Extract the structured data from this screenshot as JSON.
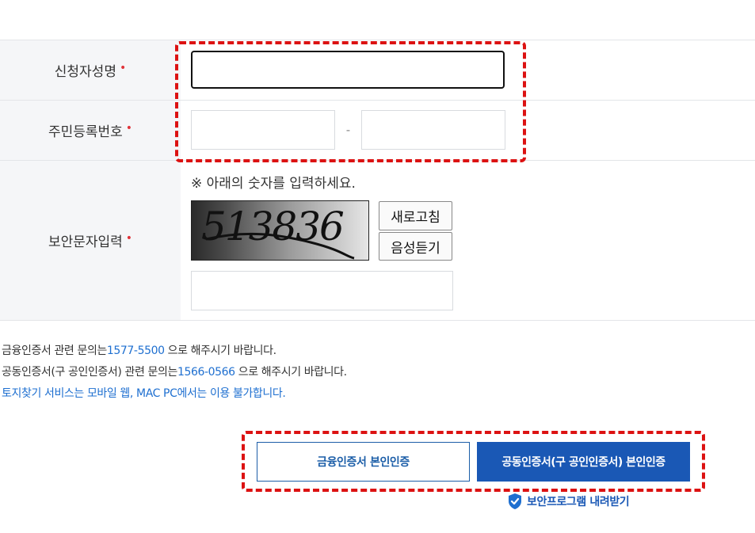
{
  "form": {
    "rows": [
      {
        "label": "신청자성명"
      },
      {
        "label": "주민등록번호"
      },
      {
        "label": "보안문자입력"
      }
    ],
    "required_mark": "•",
    "name_input": {
      "value": ""
    },
    "ssn": {
      "front_value": "",
      "separator": "-",
      "back_value": ""
    },
    "captcha": {
      "instruction": "※ 아래의 숫자를 입력하세요.",
      "code": "513836",
      "refresh_label": "새로고침",
      "audio_label": "음성듣기",
      "input_value": ""
    }
  },
  "info": {
    "line1_prefix": "금융인증서 관련 문의는",
    "line1_phone": "1577-5500",
    "line1_suffix": " 으로 해주시기 바랍니다.",
    "line2_prefix": "공동인증서(구 공인인증서) 관련 문의는",
    "line2_phone": "1566-0566",
    "line2_suffix": " 으로 해주시기 바랍니다.",
    "line3": "토지찾기 서비스는 모바일 웹, MAC PC에서는 이용 불가합니다."
  },
  "actions": {
    "financial_cert_label": "금융인증서 본인인증",
    "joint_cert_label": "공동인증서(구 공인인증서) 본인인증",
    "security_download_label": "보안프로그램 내려받기"
  },
  "colors": {
    "accent_blue": "#1a58b5",
    "link_blue": "#1e6fd0",
    "required_red": "#e0343a",
    "highlight_red": "#dc1212",
    "label_bg": "#f5f6f8"
  }
}
